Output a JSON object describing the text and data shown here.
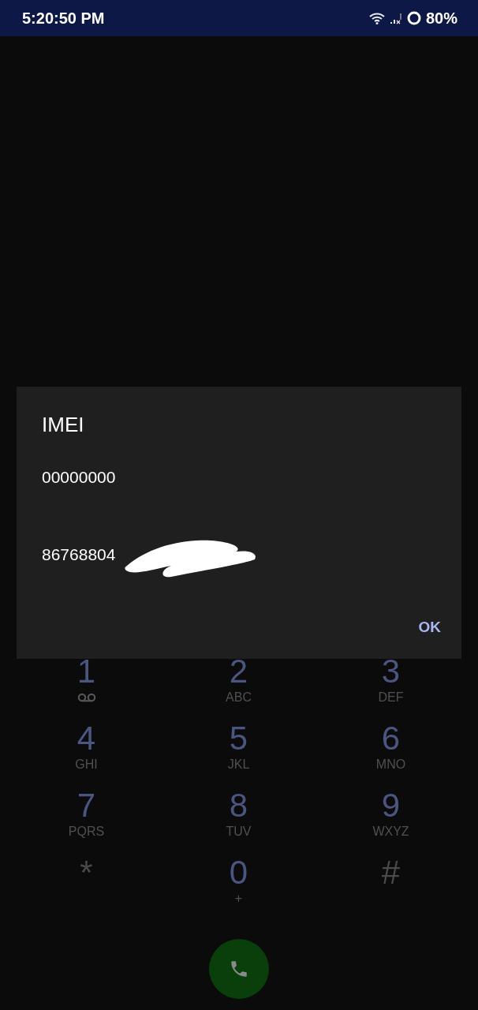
{
  "status_bar": {
    "time": "5:20:50 PM",
    "battery": "80%"
  },
  "dialog": {
    "title": "IMEI",
    "lines": [
      "00000000",
      "86768804"
    ],
    "button": "OK"
  },
  "keypad": [
    {
      "digit": "1",
      "kind": "voicemail"
    },
    {
      "digit": "2",
      "kind": "letters",
      "letters": "ABC"
    },
    {
      "digit": "3",
      "kind": "letters",
      "letters": "DEF"
    },
    {
      "digit": "4",
      "kind": "letters",
      "letters": "GHI"
    },
    {
      "digit": "5",
      "kind": "letters",
      "letters": "JKL"
    },
    {
      "digit": "6",
      "kind": "letters",
      "letters": "MNO"
    },
    {
      "digit": "7",
      "kind": "letters",
      "letters": "PQRS"
    },
    {
      "digit": "8",
      "kind": "letters",
      "letters": "TUV"
    },
    {
      "digit": "9",
      "kind": "letters",
      "letters": "WXYZ"
    },
    {
      "digit": "*",
      "kind": "symbol"
    },
    {
      "digit": "0",
      "kind": "letters",
      "letters": "+"
    },
    {
      "digit": "#",
      "kind": "symbol"
    }
  ]
}
